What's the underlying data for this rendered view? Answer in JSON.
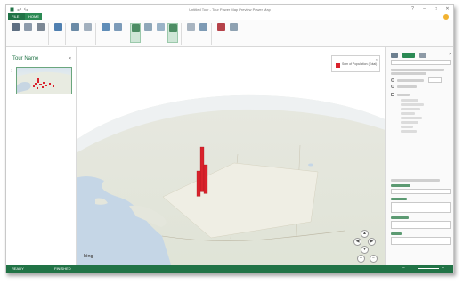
{
  "window": {
    "title": "Untitled Tour - Tour Power Map Preview Power Map"
  },
  "tabs": [
    {
      "label": "FILE"
    },
    {
      "label": "HOME"
    }
  ],
  "left_pane": {
    "title": "Tour Name",
    "close": "×",
    "scene_number": "1"
  },
  "legend": {
    "label": "Sum of Population (Total)",
    "color": "#d9222c"
  },
  "map": {
    "provider": "bing",
    "zoom_controls": [
      "+",
      "−"
    ],
    "nav_arrows": [
      "▲",
      "◀",
      "▶",
      "▼"
    ],
    "bar_color": "#d9222c"
  },
  "status": {
    "left": "READY",
    "right": "FINISHED"
  },
  "colors": {
    "accent": "#217346",
    "bars": "#d9222c"
  }
}
